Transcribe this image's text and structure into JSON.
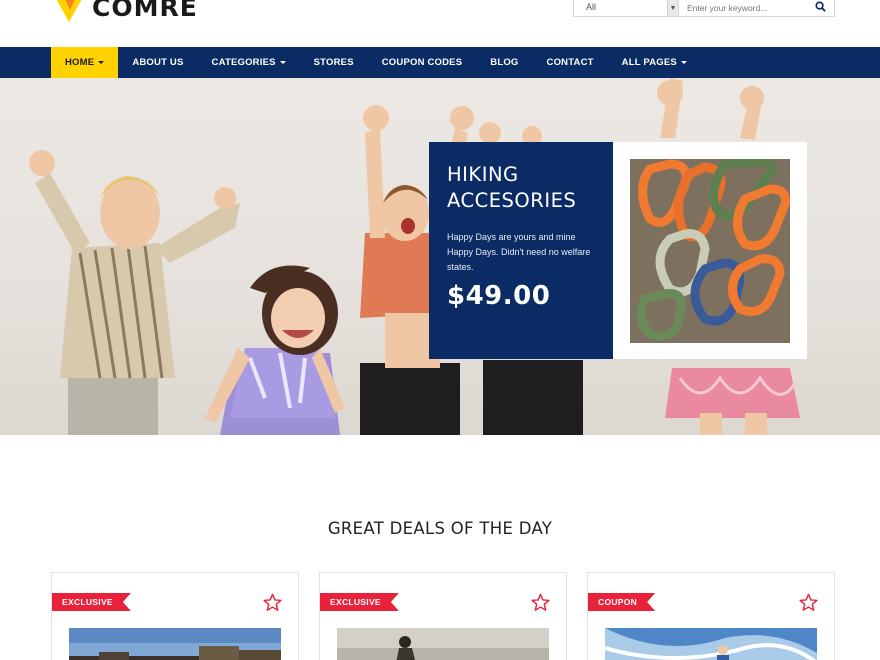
{
  "header": {
    "logo_text": "COMRE",
    "search": {
      "category_value": "All",
      "placeholder": "Enter your keyword..."
    }
  },
  "nav": {
    "items": [
      {
        "label": "HOME",
        "dropdown": true,
        "active": true
      },
      {
        "label": "ABOUT US",
        "dropdown": false
      },
      {
        "label": "CATEGORIES",
        "dropdown": true
      },
      {
        "label": "STORES",
        "dropdown": false
      },
      {
        "label": "COUPON CODES",
        "dropdown": false
      },
      {
        "label": "BLOG",
        "dropdown": false
      },
      {
        "label": "CONTACT",
        "dropdown": false
      },
      {
        "label": "ALL PAGES",
        "dropdown": true
      }
    ]
  },
  "hero": {
    "promo": {
      "title_line1": "HIKING",
      "title_line2": "ACCESORIES",
      "description": "Happy Days are yours and mine Happy Days. Didn't need no welfare states.",
      "price": "$49.00"
    }
  },
  "deals": {
    "title": "GREAT DEALS OF THE DAY",
    "cards": [
      {
        "ribbon": "EXCLUSIVE"
      },
      {
        "ribbon": "EXCLUSIVE"
      },
      {
        "ribbon": "COUPON"
      }
    ]
  },
  "colors": {
    "nav_bg": "#0a2b63",
    "active_nav": "#ffd200",
    "ribbon": "#e8223a",
    "logo_yellow": "#ffd200",
    "logo_orange": "#f5821f"
  }
}
